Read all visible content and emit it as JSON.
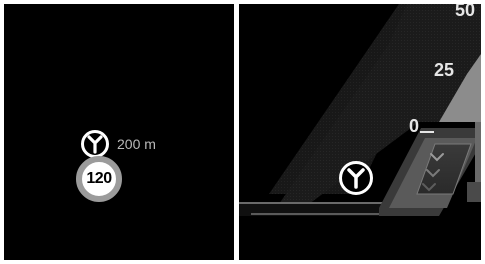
{
  "navigation": {
    "icon": "junction-icon",
    "distance": "200 m"
  },
  "speed_limit": {
    "value": "120",
    "border_color": "#9b9b9b"
  },
  "speed_tape": {
    "labels": [
      "50",
      "25",
      "0"
    ],
    "chevron_icon": "chevron-down-icon"
  }
}
